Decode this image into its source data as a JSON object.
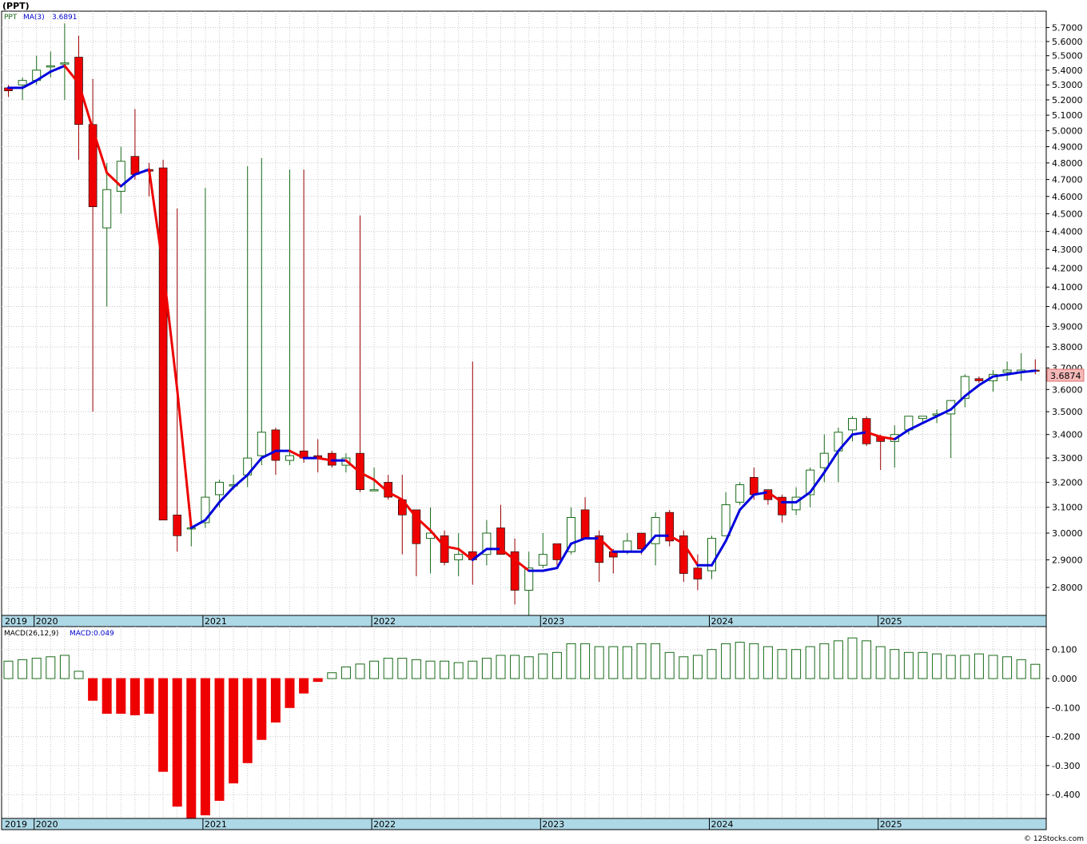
{
  "symbol_title": "(PPT)",
  "price_panel": {
    "legend_symbol": "PPT",
    "ma_label": "MA(3)",
    "ma_value": "3.6891",
    "last_price": "3.6874"
  },
  "macd_panel": {
    "legend_label": "MACD(26,12,9)",
    "value_label": "MACD:0.049"
  },
  "x_axis_years": [
    "2019",
    "2020",
    "2021",
    "2022",
    "2023",
    "2024",
    "2025"
  ],
  "price_ticks": [
    "5.7000",
    "5.6000",
    "5.5000",
    "5.4000",
    "5.3000",
    "5.2000",
    "5.1000",
    "5.0000",
    "4.9000",
    "4.8000",
    "4.7000",
    "4.6000",
    "4.5000",
    "4.4000",
    "4.3000",
    "4.2000",
    "4.1000",
    "4.0000",
    "3.9000",
    "3.8000",
    "3.7000",
    "3.6000",
    "3.5000",
    "3.4000",
    "3.3000",
    "3.2000",
    "3.1000",
    "3.0000",
    "2.9000",
    "2.8000"
  ],
  "macd_ticks": [
    "0.100",
    "0.000",
    "-0.100",
    "-0.200",
    "-0.300",
    "-0.400"
  ],
  "credit": "© 12Stocks.com",
  "colors": {
    "up_candle": "#1a6b1a",
    "down_candle": "#ee0000",
    "ma_up": "#0000dd",
    "ma_down": "#ee0000",
    "axis_band": "#add8e6",
    "grid": "#c8c8c8"
  },
  "chart_data": [
    {
      "type": "candlestick",
      "interval": "monthly",
      "ylim": [
        2.7,
        5.74
      ],
      "log_scale": true,
      "start_period": "2019-11",
      "ohlc": [
        [
          5.28,
          5.3,
          5.22,
          5.26
        ],
        [
          5.3,
          5.35,
          5.2,
          5.33
        ],
        [
          5.33,
          5.5,
          5.3,
          5.4
        ],
        [
          5.43,
          5.53,
          5.35,
          5.43
        ],
        [
          5.45,
          5.73,
          5.2,
          5.45
        ],
        [
          5.49,
          5.64,
          4.82,
          5.04
        ],
        [
          5.04,
          5.34,
          3.5,
          4.54
        ],
        [
          4.42,
          4.8,
          4.0,
          4.64
        ],
        [
          4.63,
          4.9,
          4.5,
          4.81
        ],
        [
          4.84,
          5.14,
          4.7,
          4.73
        ],
        [
          4.76,
          4.8,
          4.6,
          4.75
        ],
        [
          4.77,
          4.82,
          3.05,
          3.05
        ],
        [
          3.07,
          4.53,
          2.93,
          2.99
        ],
        [
          3.02,
          3.03,
          2.95,
          3.02
        ],
        [
          3.04,
          4.65,
          3.02,
          3.14
        ],
        [
          3.15,
          3.21,
          3.1,
          3.2
        ],
        [
          3.19,
          3.23,
          3.17,
          3.19
        ],
        [
          3.23,
          4.78,
          3.18,
          3.3
        ],
        [
          3.31,
          4.83,
          3.27,
          3.41
        ],
        [
          3.42,
          3.43,
          3.23,
          3.29
        ],
        [
          3.29,
          4.76,
          3.27,
          3.31
        ],
        [
          3.33,
          4.76,
          3.28,
          3.3
        ],
        [
          3.31,
          3.38,
          3.24,
          3.3
        ],
        [
          3.32,
          3.33,
          3.26,
          3.27
        ],
        [
          3.27,
          3.32,
          3.24,
          3.3
        ],
        [
          3.32,
          4.49,
          3.16,
          3.17
        ],
        [
          3.17,
          3.26,
          3.17,
          3.17
        ],
        [
          3.2,
          3.23,
          3.13,
          3.14
        ],
        [
          3.13,
          3.23,
          2.92,
          3.07
        ],
        [
          3.09,
          3.09,
          2.84,
          2.96
        ],
        [
          2.98,
          3.1,
          2.85,
          3.0
        ],
        [
          2.99,
          3.01,
          2.88,
          2.89
        ],
        [
          2.9,
          3.0,
          2.84,
          2.92
        ],
        [
          2.93,
          3.73,
          2.81,
          2.9
        ],
        [
          2.92,
          3.05,
          2.88,
          3.0
        ],
        [
          3.02,
          3.11,
          2.94,
          2.92
        ],
        [
          2.93,
          2.98,
          2.74,
          2.79
        ],
        [
          2.79,
          2.93,
          2.7,
          2.87
        ],
        [
          2.88,
          3.0,
          2.87,
          2.92
        ],
        [
          2.96,
          2.96,
          2.88,
          2.9
        ],
        [
          2.93,
          3.1,
          2.92,
          3.06
        ],
        [
          3.09,
          3.14,
          3.0,
          2.98
        ],
        [
          2.99,
          3.01,
          2.82,
          2.89
        ],
        [
          2.93,
          2.94,
          2.85,
          2.91
        ],
        [
          2.93,
          3.0,
          2.92,
          2.97
        ],
        [
          3.0,
          3.0,
          2.92,
          2.94
        ],
        [
          2.96,
          3.08,
          2.88,
          3.06
        ],
        [
          3.08,
          3.09,
          2.95,
          2.97
        ],
        [
          2.99,
          3.01,
          2.82,
          2.85
        ],
        [
          2.87,
          2.92,
          2.79,
          2.83
        ],
        [
          2.86,
          2.99,
          2.83,
          2.98
        ],
        [
          2.99,
          3.16,
          2.99,
          3.11
        ],
        [
          3.12,
          3.2,
          3.11,
          3.19
        ],
        [
          3.22,
          3.26,
          3.13,
          3.15
        ],
        [
          3.17,
          3.17,
          3.11,
          3.13
        ],
        [
          3.14,
          3.15,
          3.04,
          3.07
        ],
        [
          3.09,
          3.18,
          3.07,
          3.14
        ],
        [
          3.15,
          3.26,
          3.1,
          3.25
        ],
        [
          3.26,
          3.4,
          3.2,
          3.32
        ],
        [
          3.33,
          3.43,
          3.2,
          3.41
        ],
        [
          3.42,
          3.48,
          3.37,
          3.47
        ],
        [
          3.47,
          3.48,
          3.35,
          3.36
        ],
        [
          3.39,
          3.4,
          3.25,
          3.37
        ],
        [
          3.37,
          3.44,
          3.26,
          3.4
        ],
        [
          3.42,
          3.48,
          3.4,
          3.48
        ],
        [
          3.47,
          3.48,
          3.45,
          3.48
        ],
        [
          3.49,
          3.51,
          3.45,
          3.49
        ],
        [
          3.49,
          3.55,
          3.3,
          3.55
        ],
        [
          3.56,
          3.67,
          3.52,
          3.66
        ],
        [
          3.65,
          3.66,
          3.63,
          3.64
        ],
        [
          3.64,
          3.69,
          3.59,
          3.67
        ],
        [
          3.68,
          3.73,
          3.64,
          3.69
        ],
        [
          3.68,
          3.77,
          3.64,
          3.69
        ],
        [
          3.69,
          3.74,
          3.67,
          3.687
        ]
      ],
      "ma3": [
        5.28,
        5.28,
        5.33,
        5.39,
        5.43,
        5.31,
        5.01,
        4.74,
        4.66,
        4.73,
        4.76,
        4.2,
        3.6,
        3.02,
        3.05,
        3.12,
        3.18,
        3.23,
        3.3,
        3.33,
        3.33,
        3.3,
        3.3,
        3.29,
        3.29,
        3.24,
        3.21,
        3.16,
        3.13,
        3.06,
        3.01,
        2.95,
        2.94,
        2.9,
        2.94,
        2.94,
        2.9,
        2.86,
        2.86,
        2.87,
        2.96,
        2.98,
        2.98,
        2.93,
        2.93,
        2.93,
        2.99,
        2.99,
        2.96,
        2.88,
        2.88,
        2.97,
        3.09,
        3.15,
        3.16,
        3.12,
        3.12,
        3.16,
        3.24,
        3.33,
        3.4,
        3.41,
        3.39,
        3.38,
        3.42,
        3.45,
        3.48,
        3.51,
        3.57,
        3.62,
        3.66,
        3.67,
        3.68,
        3.687
      ]
    },
    {
      "type": "bar",
      "title": "MACD(26,12,9)",
      "ylim": [
        -0.49,
        0.11
      ],
      "values": [
        0.06,
        0.065,
        0.07,
        0.075,
        0.08,
        0.025,
        -0.075,
        -0.12,
        -0.12,
        -0.125,
        -0.12,
        -0.32,
        -0.44,
        -0.49,
        -0.47,
        -0.42,
        -0.36,
        -0.29,
        -0.21,
        -0.15,
        -0.1,
        -0.05,
        -0.01,
        0.02,
        0.04,
        0.05,
        0.06,
        0.07,
        0.07,
        0.065,
        0.06,
        0.06,
        0.055,
        0.06,
        0.07,
        0.08,
        0.08,
        0.075,
        0.085,
        0.09,
        0.12,
        0.12,
        0.11,
        0.11,
        0.11,
        0.12,
        0.12,
        0.09,
        0.075,
        0.08,
        0.1,
        0.12,
        0.125,
        0.12,
        0.11,
        0.1,
        0.1,
        0.11,
        0.12,
        0.13,
        0.14,
        0.13,
        0.11,
        0.1,
        0.09,
        0.09,
        0.085,
        0.08,
        0.08,
        0.085,
        0.08,
        0.075,
        0.065,
        0.049
      ]
    }
  ]
}
